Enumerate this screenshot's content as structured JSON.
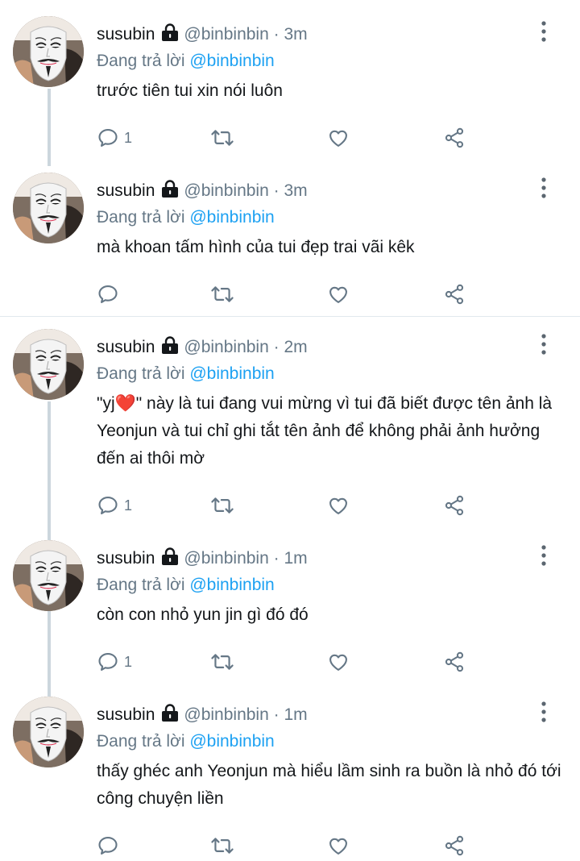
{
  "colors": {
    "text": "#14171a",
    "secondary": "#657786",
    "link": "#1da1f2",
    "thread_line": "#ccd6dd",
    "divider": "#e1e8ed"
  },
  "icons": {
    "lock": "lock-icon",
    "more": "more-vertical-icon",
    "reply": "reply-icon",
    "retweet": "retweet-icon",
    "like": "heart-icon",
    "share": "share-icon"
  },
  "tweets": [
    {
      "name": "susubin",
      "handle": "@binbinbin",
      "dot": "·",
      "time": "3m",
      "reply_prefix": "Đang trả lời",
      "reply_handle": "@binbinbin",
      "text": "trước tiên tui xin nói luôn",
      "reply_count": "1"
    },
    {
      "name": "susubin",
      "handle": "@binbinbin",
      "dot": "·",
      "time": "3m",
      "reply_prefix": "Đang trả lời",
      "reply_handle": "@binbinbin",
      "text": "mà khoan tấm hình của tui đẹp trai vãi kêk",
      "reply_count": ""
    },
    {
      "name": "susubin",
      "handle": "@binbinbin",
      "dot": "·",
      "time": "2m",
      "reply_prefix": "Đang trả lời",
      "reply_handle": "@binbinbin",
      "text": "\"yj❤️\" này là tui đang vui mừng vì tui đã biết được tên ảnh là Yeonjun và tui chỉ ghi tắt tên ảnh để không phải ảnh hưởng đến ai thôi mờ",
      "reply_count": "1"
    },
    {
      "name": "susubin",
      "handle": "@binbinbin",
      "dot": "·",
      "time": "1m",
      "reply_prefix": "Đang trả lời",
      "reply_handle": "@binbinbin",
      "text": "còn con nhỏ yun jin gì đó đó",
      "reply_count": "1"
    },
    {
      "name": "susubin",
      "handle": "@binbinbin",
      "dot": "·",
      "time": "1m",
      "reply_prefix": "Đang trả lời",
      "reply_handle": "@binbinbin",
      "text": "thấy ghéc anh Yeonjun mà hiểu lầm sinh ra buồn là nhỏ đó tới công chuyện liền",
      "reply_count": ""
    }
  ]
}
